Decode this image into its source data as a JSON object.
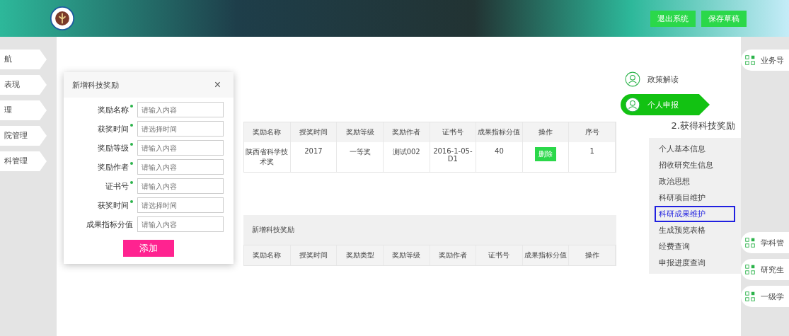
{
  "header": {
    "buttons": [
      {
        "label": "退出系统"
      },
      {
        "label": "保存草稿"
      }
    ]
  },
  "left_nav": [
    {
      "label": "航"
    },
    {
      "label": "表现"
    },
    {
      "label": "理"
    },
    {
      "label": "院管理"
    },
    {
      "label": "科管理"
    }
  ],
  "right_nav": [
    {
      "label": "业务导"
    },
    {
      "label": "学科管"
    },
    {
      "label": "研究生"
    },
    {
      "label": "一级学"
    }
  ],
  "top_table": {
    "columns": [
      "奖励名称",
      "授奖时间",
      "奖励等级",
      "奖励作者",
      "证书号",
      "成果指标分值",
      "操作",
      "序号"
    ],
    "rows": [
      {
        "cells": [
          "陕西省科学技术奖",
          "2017",
          "一等奖",
          "测试002",
          "2016-1-05-D1",
          "40"
        ],
        "action": "删除",
        "index": "1"
      }
    ]
  },
  "dialog": {
    "title": "新增科技奖励",
    "close": "×",
    "fields": [
      {
        "label": "奖励名称",
        "required": true,
        "placeholder": "请输入内容"
      },
      {
        "label": "获奖时间",
        "required": true,
        "placeholder": "请选择时间"
      },
      {
        "label": "奖励等级",
        "required": true,
        "placeholder": "请输入内容"
      },
      {
        "label": "奖励作者",
        "required": true,
        "placeholder": "请输入内容"
      },
      {
        "label": "证书号",
        "required": true,
        "placeholder": "请输入内容"
      },
      {
        "label": "获奖时间",
        "required": true,
        "placeholder": "请选择时间"
      },
      {
        "label": "成果指标分值",
        "required": false,
        "placeholder": "请输入内容"
      }
    ],
    "submit": "添加"
  },
  "floating_menu": {
    "items": [
      {
        "label": "政策解读",
        "selected": false
      },
      {
        "label": "个人申报",
        "selected": true
      }
    ],
    "section_title": "2.获得科技奖励",
    "subitems": [
      {
        "label": "个人基本信息",
        "selected": false
      },
      {
        "label": "招收研究生信息",
        "selected": false
      },
      {
        "label": "政治思想",
        "selected": false
      },
      {
        "label": "科研项目维护",
        "selected": false
      },
      {
        "label": "科研成果维护",
        "selected": true
      },
      {
        "label": "生成预览表格",
        "selected": false
      },
      {
        "label": "经费查询",
        "selected": false
      },
      {
        "label": "申报进度查询",
        "selected": false
      }
    ]
  },
  "section": {
    "label": "新增科技奖励",
    "columns": [
      "奖励名称",
      "授奖时间",
      "奖励类型",
      "奖励等级",
      "奖励作者",
      "证书号",
      "成果指标分值",
      "操作"
    ]
  }
}
